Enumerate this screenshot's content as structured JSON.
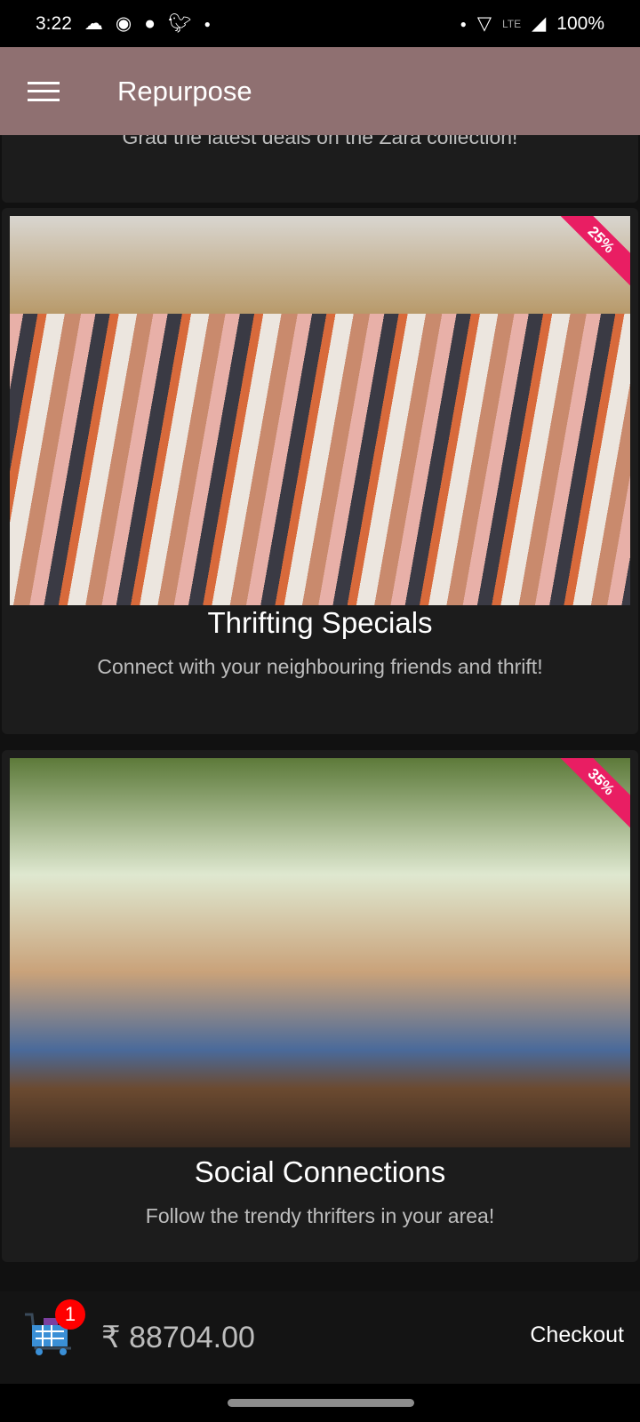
{
  "status": {
    "time": "3:22",
    "network": "LTE",
    "battery": "100%"
  },
  "appbar": {
    "title": "Repurpose"
  },
  "cards": [
    {
      "subtitle": "Grad the latest deals on the Zara collection!"
    },
    {
      "title": "Thrifting Specials",
      "subtitle": "Connect with your neighbouring friends and thrift!",
      "discount": "25%"
    },
    {
      "title": "Social Connections",
      "subtitle": "Follow the trendy thrifters in your area!",
      "discount": "35%"
    }
  ],
  "cart": {
    "count": "1",
    "total": "₹ 88704.00",
    "checkout_label": "Checkout"
  },
  "colors": {
    "appbar": "#8f7071",
    "ribbon": "#e91e63",
    "badge": "#ff0000"
  }
}
